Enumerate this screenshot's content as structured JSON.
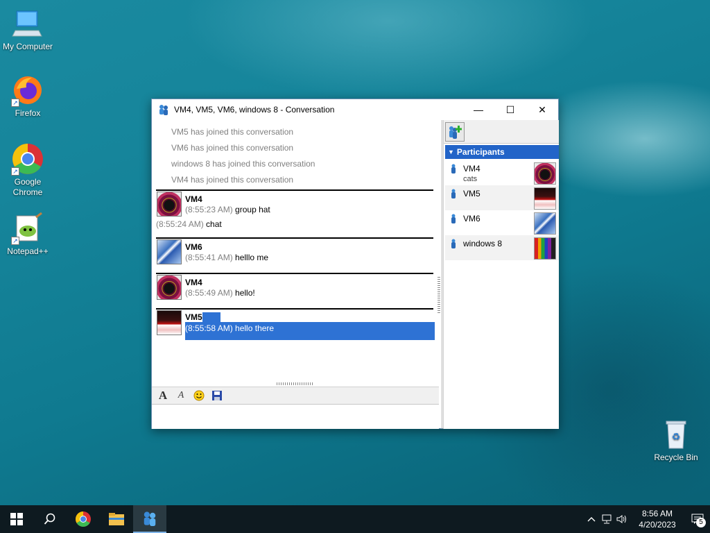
{
  "desktop": {
    "icons": [
      {
        "label": "My Computer"
      },
      {
        "label": "Firefox"
      },
      {
        "label": "Google Chrome"
      },
      {
        "label": "Notepad++"
      },
      {
        "label": "Recycle Bin"
      }
    ]
  },
  "window": {
    "title": "VM4, VM5, VM6, windows 8 - Conversation",
    "controls": {
      "minimize": "—",
      "maximize": "☐",
      "close": "✕"
    }
  },
  "chat": {
    "system_messages": [
      "VM5 has joined this conversation",
      "VM6 has joined this conversation",
      "windows 8 has joined this conversation",
      "VM4 has joined this conversation"
    ],
    "messages": [
      {
        "sender": "VM4",
        "lines": [
          {
            "time": "(8:55:23 AM)",
            "text": "group hat"
          },
          {
            "time": "(8:55:24 AM)",
            "text": "chat"
          }
        ]
      },
      {
        "sender": "VM6",
        "lines": [
          {
            "time": "(8:55:41 AM)",
            "text": "helllo me"
          }
        ]
      },
      {
        "sender": "VM4",
        "lines": [
          {
            "time": "(8:55:49 AM)",
            "text": "hello!"
          }
        ]
      },
      {
        "sender": "VM5",
        "lines": [
          {
            "time": "(8:55:58 AM)",
            "text": "hello there"
          }
        ]
      }
    ]
  },
  "format_toolbar": {
    "font": "A",
    "font_style": "A",
    "emoticon": "☺",
    "save": "💾"
  },
  "participants": {
    "header": "Participants",
    "list": [
      {
        "name": "VM4",
        "status": "cats"
      },
      {
        "name": "VM5",
        "status": ""
      },
      {
        "name": "VM6",
        "status": ""
      },
      {
        "name": "windows 8",
        "status": ""
      }
    ]
  },
  "taskbar": {
    "clock_time": "8:56 AM",
    "clock_date": "4/20/2023",
    "notification_count": "5"
  }
}
